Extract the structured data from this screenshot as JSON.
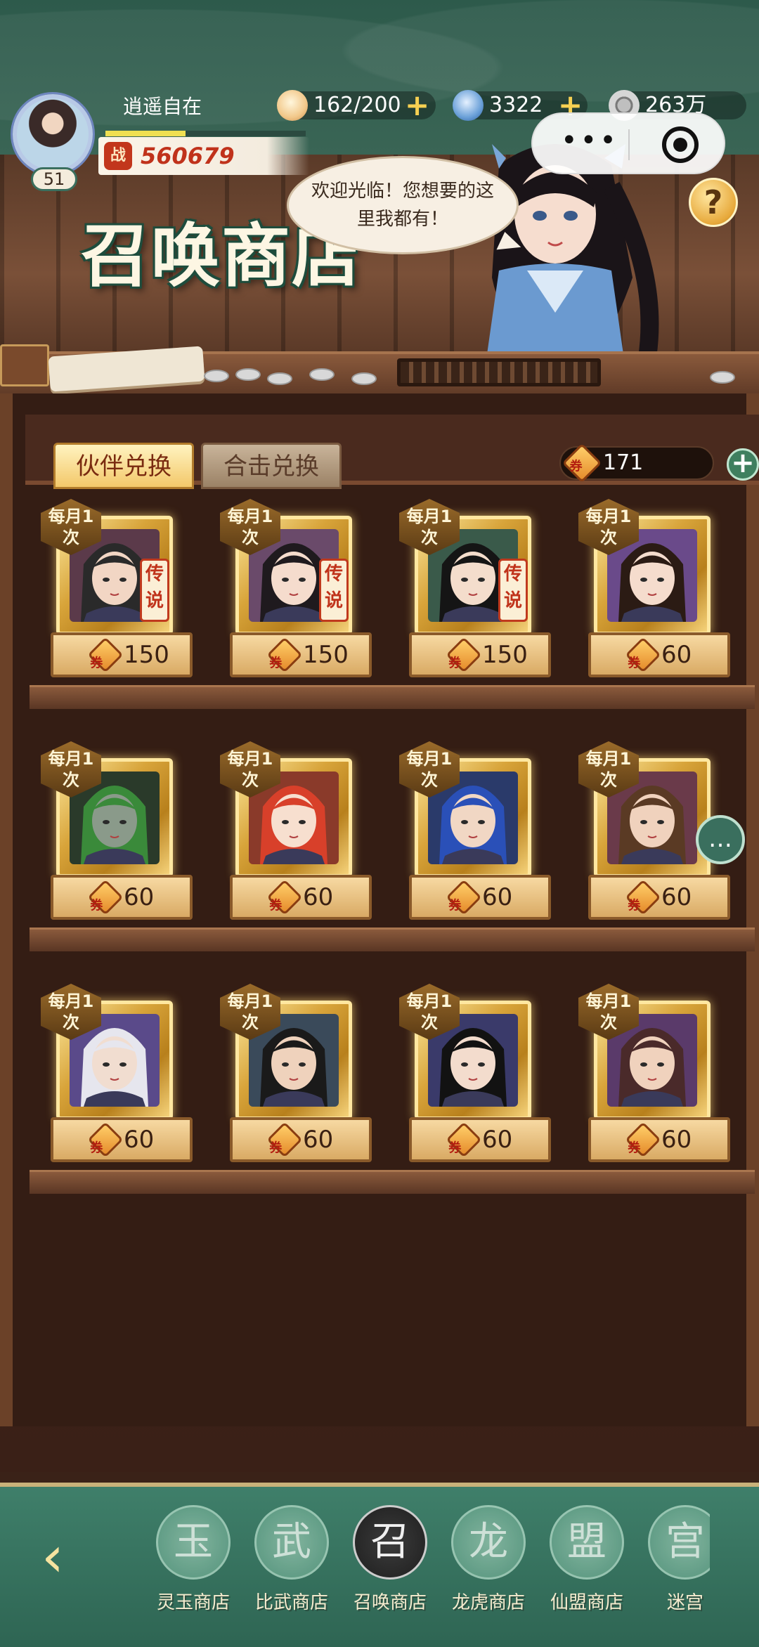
{
  "player": {
    "name": "逍遥自在",
    "level": "51",
    "power_label": "战",
    "power": "560679"
  },
  "resources": [
    {
      "icon": "bun-icon",
      "value": "162/200",
      "has_plus": true
    },
    {
      "icon": "jade-swirl-icon",
      "value": "3322",
      "has_plus": true
    },
    {
      "icon": "copper-coin-icon",
      "value": "263万",
      "has_plus": false
    }
  ],
  "shop": {
    "title": "召唤商店",
    "greeting": "欢迎光临！您想要的这里我都有！",
    "help": "?"
  },
  "tabs": [
    {
      "label": "伙伴兑换",
      "active": true
    },
    {
      "label": "合击兑换",
      "active": false
    }
  ],
  "balance": {
    "icon": "summon-token-icon",
    "value": "171"
  },
  "items_badge": "每月1次",
  "legend_tag": "传说",
  "items": [
    {
      "price": "150",
      "legend": true,
      "hair": "#2a2a2a",
      "bg": "#5b3a4a",
      "skin": "#f2d6c4"
    },
    {
      "price": "150",
      "legend": true,
      "hair": "#1f1a1e",
      "bg": "#6a4a6a",
      "skin": "#f5dccd"
    },
    {
      "price": "150",
      "legend": true,
      "hair": "#151515",
      "bg": "#3a5a4a",
      "skin": "#f4ddcc"
    },
    {
      "price": "60",
      "legend": false,
      "hair": "#2b1b14",
      "bg": "#6a4a8a",
      "skin": "#f5dccd"
    },
    {
      "price": "60",
      "legend": false,
      "hair": "#3a8a3a",
      "bg": "#2a3a2a",
      "skin": "#8a9a8a"
    },
    {
      "price": "60",
      "legend": false,
      "hair": "#d8402a",
      "bg": "#8a3a2a",
      "skin": "#f7dfcf"
    },
    {
      "price": "60",
      "legend": false,
      "hair": "#2a50b8",
      "bg": "#2a3a6a",
      "skin": "#f1d7c4"
    },
    {
      "price": "60",
      "legend": false,
      "hair": "#5a3a24",
      "bg": "#6a3a4a",
      "skin": "#f0d2bd"
    },
    {
      "price": "60",
      "legend": false,
      "hair": "#e6e6ee",
      "bg": "#5a4a8a",
      "skin": "#f1ddd0"
    },
    {
      "price": "60",
      "legend": false,
      "hair": "#1a1a1a",
      "bg": "#3a4a5a",
      "skin": "#efd2bc"
    },
    {
      "price": "60",
      "legend": false,
      "hair": "#121212",
      "bg": "#3a3a6a",
      "skin": "#f3dccd"
    },
    {
      "price": "60",
      "legend": false,
      "hair": "#4a2a2a",
      "bg": "#5a3a6a",
      "skin": "#f0d2bd"
    }
  ],
  "nav": [
    {
      "label": "灵玉商店",
      "mark": "玉",
      "active": false
    },
    {
      "label": "比武商店",
      "mark": "武",
      "active": false
    },
    {
      "label": "召唤商店",
      "mark": "召",
      "active": true
    },
    {
      "label": "龙虎商店",
      "mark": "龙",
      "active": false
    },
    {
      "label": "仙盟商店",
      "mark": "盟",
      "active": false
    },
    {
      "label": "迷宫",
      "mark": "宫",
      "active": false
    }
  ],
  "colors": {
    "header_green": "#2f5b4c",
    "accent_gold": "#f3c86a",
    "price_red": "#c0321b"
  }
}
